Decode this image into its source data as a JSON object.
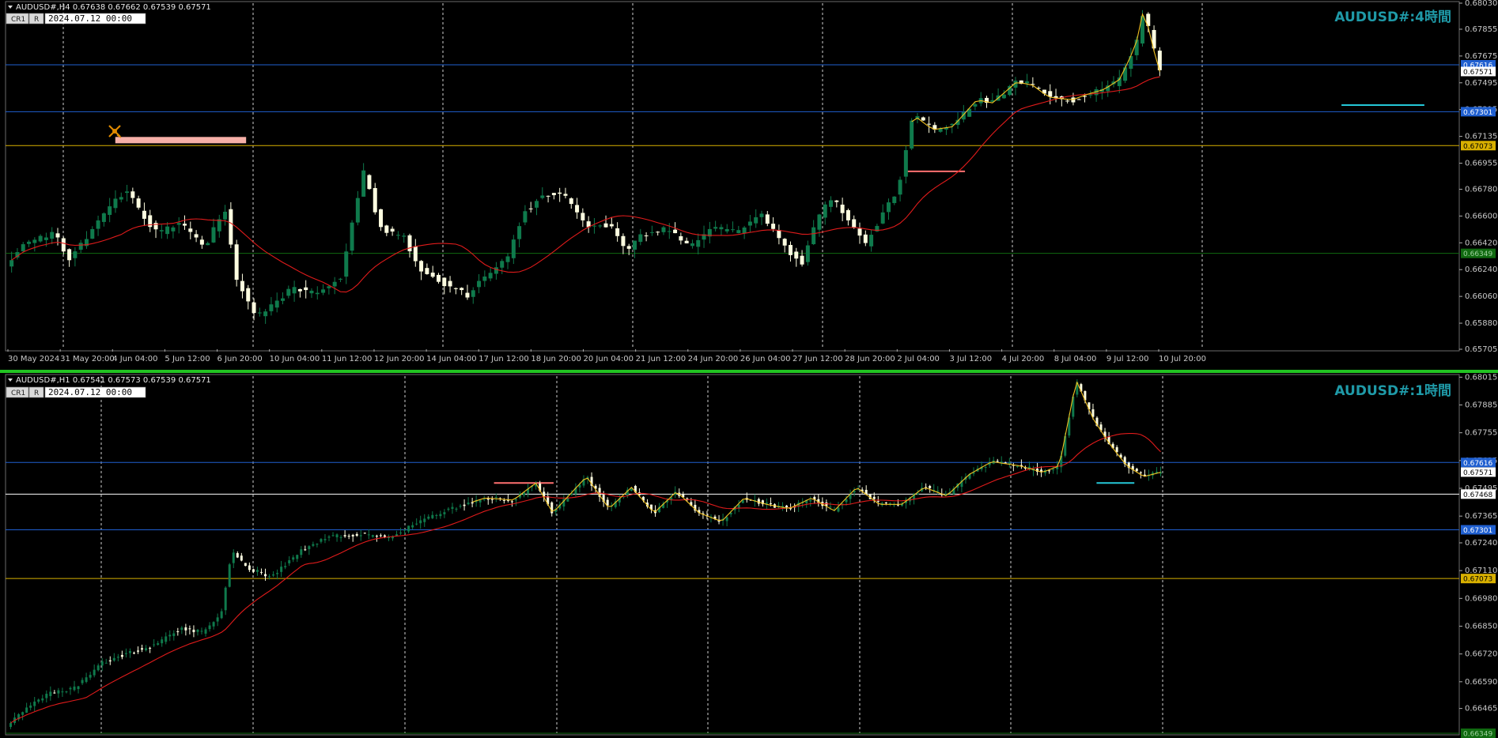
{
  "colors": {
    "background": "#000000",
    "bull": "#0f7a4c",
    "bear": "#fdfde0",
    "ma_red": "#e01b1b",
    "zigzag": "#f0c020",
    "blue_line": "#1f5fd0",
    "yellow_line": "#d8b000",
    "green_line": "#106a10",
    "white_line": "#ffffff",
    "title": "#1f9aa8",
    "grid": "#cfcfcf",
    "pink": "#f7b0a8",
    "cyan": "#25c8d8",
    "salmon": "#ff7070",
    "separator": "#22c322"
  },
  "chart_data": [
    {
      "type": "candlestick",
      "symbol_header": "AUDUSD#,H4  0.67638 0.67662 0.67539 0.67571",
      "button_1": "CR1",
      "button_2": "R",
      "datetime_field": "2024.07.12 00:00",
      "title": "AUDUSD#:4時間",
      "ylim": [
        0.65705,
        0.6803
      ],
      "y_ticks": [
        "0.68030",
        "0.67855",
        "0.67675",
        "0.67495",
        "0.67315",
        "0.67135",
        "0.66955",
        "0.66780",
        "0.66600",
        "0.66420",
        "0.66240",
        "0.66060",
        "0.65880",
        "0.65705"
      ],
      "x_labels": [
        "30 May 2024",
        "31 May 20:00",
        "4 Jun 04:00",
        "5 Jun 12:00",
        "6 Jun 20:00",
        "10 Jun 04:00",
        "11 Jun 12:00",
        "12 Jun 20:00",
        "14 Jun 04:00",
        "17 Jun 12:00",
        "18 Jun 20:00",
        "20 Jun 04:00",
        "21 Jun 12:00",
        "24 Jun 20:00",
        "26 Jun 04:00",
        "27 Jun 12:00",
        "28 Jun 20:00",
        "2 Jul 04:00",
        "3 Jul 12:00",
        "4 Jul 20:00",
        "8 Jul 04:00",
        "9 Jul 12:00",
        "10 Jul 20:00"
      ],
      "bar_count": 200,
      "anchors": [
        [
          0,
          0.6628
        ],
        [
          5,
          0.6642
        ],
        [
          12,
          0.6648
        ],
        [
          16,
          0.6632
        ],
        [
          24,
          0.6658
        ],
        [
          30,
          0.6678
        ],
        [
          38,
          0.6648
        ],
        [
          44,
          0.6655
        ],
        [
          50,
          0.664
        ],
        [
          55,
          0.6665
        ],
        [
          58,
          0.6618
        ],
        [
          63,
          0.6592
        ],
        [
          66,
          0.6597
        ],
        [
          72,
          0.6612
        ],
        [
          78,
          0.6607
        ],
        [
          84,
          0.6618
        ],
        [
          90,
          0.669
        ],
        [
          94,
          0.6652
        ],
        [
          100,
          0.6646
        ],
        [
          104,
          0.6625
        ],
        [
          110,
          0.6615
        ],
        [
          116,
          0.6607
        ],
        [
          120,
          0.6618
        ],
        [
          126,
          0.6632
        ],
        [
          130,
          0.6662
        ],
        [
          135,
          0.6674
        ],
        [
          140,
          0.6676
        ],
        [
          146,
          0.6652
        ],
        [
          152,
          0.6654
        ],
        [
          156,
          0.6638
        ],
        [
          160,
          0.6647
        ],
        [
          166,
          0.6652
        ],
        [
          172,
          0.664
        ],
        [
          178,
          0.6652
        ],
        [
          184,
          0.665
        ],
        [
          190,
          0.666
        ],
        [
          196,
          0.6638
        ],
        [
          200,
          0.6628
        ],
        [
          203,
          0.6652
        ],
        [
          207,
          0.6673
        ],
        [
          212,
          0.6658
        ],
        [
          216,
          0.6641
        ],
        [
          220,
          0.666
        ],
        [
          224,
          0.6676
        ],
        [
          228,
          0.6728
        ],
        [
          233,
          0.6718
        ],
        [
          238,
          0.672
        ],
        [
          244,
          0.6738
        ],
        [
          248,
          0.6736
        ],
        [
          254,
          0.675
        ],
        [
          258,
          0.6748
        ],
        [
          262,
          0.674
        ],
        [
          268,
          0.6738
        ],
        [
          272,
          0.6742
        ],
        [
          276,
          0.6745
        ],
        [
          280,
          0.6752
        ],
        [
          284,
          0.6775
        ],
        [
          286,
          0.68
        ],
        [
          288,
          0.6776
        ],
        [
          290,
          0.6757
        ]
      ],
      "levels": [
        {
          "value": "0.67616",
          "color": "#1f5fd0",
          "label_bg": "#1f5fd0",
          "label_color": "#ffffff"
        },
        {
          "value": "0.67571",
          "color": "",
          "label_bg": "#ffffff",
          "label_color": "#000000"
        },
        {
          "value": "0.67301",
          "color": "#1f5fd0",
          "label_bg": "#1f5fd0",
          "label_color": "#ffffff"
        },
        {
          "value": "0.67073",
          "color": "#d8b000",
          "label_bg": "#d8b000",
          "label_color": "#000000"
        },
        {
          "value": "0.66349",
          "color": "#106a10",
          "label_bg": "#106a10",
          "label_color": "#9fd09f"
        }
      ],
      "drawings": [
        {
          "kind": "pink_bar",
          "x1": 0.0755,
          "x2": 0.1655,
          "y": 0.6711
        },
        {
          "kind": "salmon_line",
          "x1": 0.619,
          "x2": 0.66,
          "y": 0.669
        },
        {
          "kind": "cyan_line",
          "x1": 0.919,
          "x2": 0.976,
          "y": 0.67345
        }
      ]
    },
    {
      "type": "candlestick",
      "symbol_header": "AUDUSD#,H1  0.67541 0.67573 0.67539 0.67571",
      "button_1": "CR1",
      "button_2": "R",
      "datetime_field": "2024.07.12 00:00",
      "title": "AUDUSD#:1時間",
      "ylim": [
        0.66349,
        0.6802
      ],
      "y_ticks": [
        "0.68015",
        "0.67885",
        "0.67755",
        "0.67625",
        "0.67495",
        "0.67365",
        "0.67240",
        "0.67110",
        "0.66980",
        "0.66850",
        "0.66720",
        "0.66590",
        "0.66465"
      ],
      "bar_count": 290,
      "anchors": [
        [
          0,
          0.6638
        ],
        [
          8,
          0.6648
        ],
        [
          16,
          0.6654
        ],
        [
          24,
          0.6656
        ],
        [
          34,
          0.6668
        ],
        [
          42,
          0.6672
        ],
        [
          52,
          0.6676
        ],
        [
          62,
          0.6684
        ],
        [
          70,
          0.6682
        ],
        [
          76,
          0.669
        ],
        [
          80,
          0.672
        ],
        [
          86,
          0.6712
        ],
        [
          94,
          0.6708
        ],
        [
          104,
          0.672
        ],
        [
          114,
          0.6727
        ],
        [
          126,
          0.6728
        ],
        [
          136,
          0.6726
        ],
        [
          148,
          0.6735
        ],
        [
          158,
          0.674
        ],
        [
          170,
          0.6745
        ],
        [
          180,
          0.6744
        ],
        [
          188,
          0.6752
        ],
        [
          194,
          0.6738
        ],
        [
          206,
          0.6755
        ],
        [
          214,
          0.674
        ],
        [
          222,
          0.675
        ],
        [
          230,
          0.6738
        ],
        [
          238,
          0.6748
        ],
        [
          246,
          0.6738
        ],
        [
          254,
          0.6734
        ],
        [
          262,
          0.6745
        ],
        [
          270,
          0.6742
        ],
        [
          278,
          0.674
        ],
        [
          286,
          0.6745
        ],
        [
          294,
          0.6739
        ],
        [
          302,
          0.675
        ],
        [
          310,
          0.6742
        ],
        [
          318,
          0.6742
        ],
        [
          326,
          0.675
        ],
        [
          334,
          0.6746
        ],
        [
          342,
          0.6756
        ],
        [
          350,
          0.6762
        ],
        [
          360,
          0.676
        ],
        [
          368,
          0.6757
        ],
        [
          374,
          0.676
        ],
        [
          380,
          0.68
        ],
        [
          386,
          0.6782
        ],
        [
          392,
          0.677
        ],
        [
          398,
          0.676
        ],
        [
          404,
          0.6755
        ],
        [
          410,
          0.6757
        ]
      ],
      "levels": [
        {
          "value": "0.67616",
          "color": "#1f5fd0",
          "label_bg": "#1f5fd0",
          "label_color": "#ffffff"
        },
        {
          "value": "0.67571",
          "color": "",
          "label_bg": "#ffffff",
          "label_color": "#000000"
        },
        {
          "value": "0.67468",
          "color": "#ffffff",
          "label_bg": "#ffffff",
          "label_color": "#000000"
        },
        {
          "value": "0.67301",
          "color": "#1f5fd0",
          "label_bg": "#1f5fd0",
          "label_color": "#ffffff"
        },
        {
          "value": "0.67073",
          "color": "#d8b000",
          "label_bg": "#d8b000",
          "label_color": "#000000"
        },
        {
          "value": "0.66349",
          "color": "#106a10",
          "label_bg": "#106a10",
          "label_color": "#9fd09f"
        }
      ],
      "drawings": [
        {
          "kind": "salmon_line",
          "x1": 0.336,
          "x2": 0.377,
          "y": 0.6752
        },
        {
          "kind": "cyan_line",
          "x1": 0.7505,
          "x2": 0.7765,
          "y": 0.6752
        }
      ]
    }
  ]
}
